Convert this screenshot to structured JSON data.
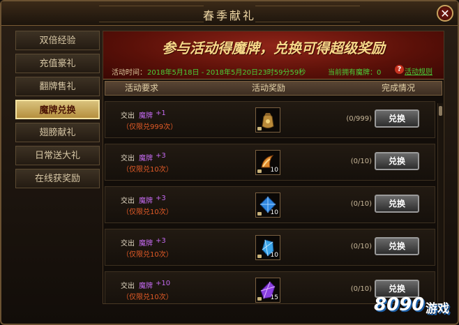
{
  "window": {
    "title": "春季献礼",
    "close_label": "✕"
  },
  "sidebar": {
    "items": [
      {
        "label": "双倍经验"
      },
      {
        "label": "充值豪礼"
      },
      {
        "label": "翻牌售礼"
      },
      {
        "label": "魔牌兑换"
      },
      {
        "label": "翅膀献礼"
      },
      {
        "label": "日常送大礼"
      },
      {
        "label": "在线获奖励"
      }
    ],
    "active_index": 3
  },
  "banner": {
    "slogan": "参与活动得魔牌，兑换可得超级奖励",
    "time_label": "活动时间：",
    "time_value": "2018年5月18日 - 2018年5月20日23时59分59秒",
    "owned_text": "当前拥有魔牌：0",
    "help_label": "?",
    "rules_link": "活动规则"
  },
  "columns": {
    "requirement": "活动要求",
    "reward": "活动奖励",
    "status": "完成情况"
  },
  "rows": [
    {
      "label": "交出",
      "item": "魔牌",
      "qty": "+1",
      "limit": "（仅限兑999次）",
      "reward_icon": "money-bag-icon",
      "reward_count": "",
      "progress": "(0/999)",
      "button": "兑换"
    },
    {
      "label": "交出",
      "item": "魔牌",
      "qty": "+3",
      "limit": "（仅限兑10次）",
      "reward_icon": "horn-icon",
      "reward_count": "10",
      "progress": "(0/10)",
      "button": "兑换"
    },
    {
      "label": "交出",
      "item": "魔牌",
      "qty": "+3",
      "limit": "（仅限兑10次）",
      "reward_icon": "blue-diamond-icon",
      "reward_count": "10",
      "progress": "(0/10)",
      "button": "兑换"
    },
    {
      "label": "交出",
      "item": "魔牌",
      "qty": "+3",
      "limit": "（仅限兑10次）",
      "reward_icon": "blue-crystal-icon",
      "reward_count": "10",
      "progress": "(0/10)",
      "button": "兑换"
    },
    {
      "label": "交出",
      "item": "魔牌",
      "qty": "+10",
      "limit": "（仅限兑10次）",
      "reward_icon": "purple-crystal-icon",
      "reward_count": "15",
      "progress": "(0/10)",
      "button": "兑换"
    }
  ],
  "watermark": {
    "number": "8090",
    "text": "游戏"
  }
}
